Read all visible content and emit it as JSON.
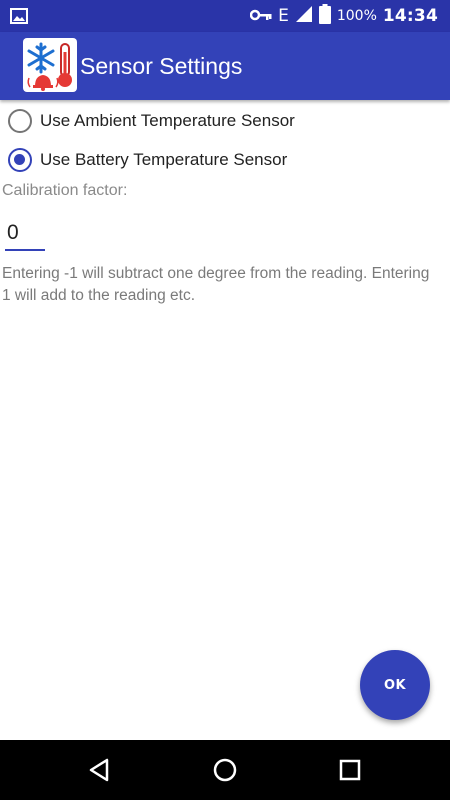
{
  "status_bar": {
    "time": "14:34",
    "battery_percent": "100%",
    "network": "E",
    "icons": [
      "image-icon",
      "key-icon",
      "signal-icon",
      "battery-icon"
    ]
  },
  "app_bar": {
    "title": "Sensor Settings",
    "logo_icon": "snowflake-thermometer-bell-logo",
    "color": "#3342b8"
  },
  "sensor_options": [
    {
      "label": "Use Ambient Temperature Sensor",
      "checked": false
    },
    {
      "label": "Use Battery Temperature Sensor",
      "checked": true
    }
  ],
  "calibration": {
    "label": "Calibration factor:",
    "value": "0",
    "hint": "Entering -1 will subtract one degree from the reading. Entering 1 will add to the reading etc."
  },
  "ok_button": {
    "label": "OK"
  },
  "nav_bar": {
    "icons": [
      "back-icon",
      "home-icon",
      "recents-icon"
    ]
  },
  "colors": {
    "primary": "#3342b8",
    "status_bar": "#2a34a8",
    "text_secondary": "#7a7a7a"
  }
}
